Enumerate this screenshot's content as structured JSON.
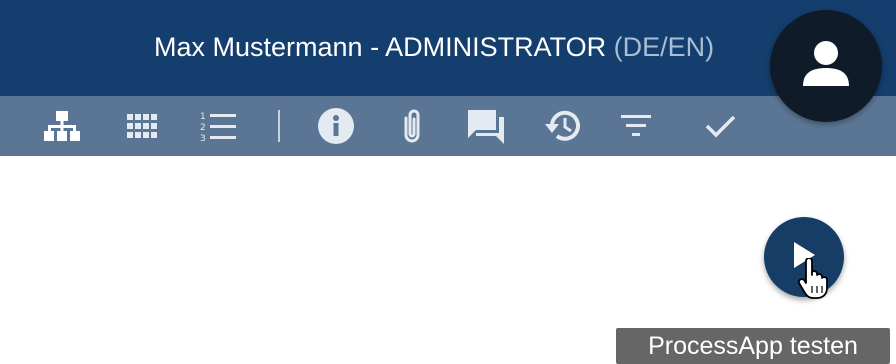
{
  "header": {
    "user_text": "Max Mustermann - ADMINISTRATOR",
    "language": "(DE/EN)"
  },
  "toolbar": {
    "icons": [
      {
        "name": "hierarchy-icon",
        "color": "#ffffff"
      },
      {
        "name": "grid-icon",
        "color": "#e4eaf1"
      },
      {
        "name": "numbered-list-icon",
        "color": "#e4eaf1"
      },
      {
        "name": "info-icon",
        "color": "#e4eaf1"
      },
      {
        "name": "attachment-icon",
        "color": "#e4eaf1"
      },
      {
        "name": "comments-icon",
        "color": "#e4eaf1"
      },
      {
        "name": "history-icon",
        "color": "#e4eaf1"
      },
      {
        "name": "filter-icon",
        "color": "#e4eaf1"
      },
      {
        "name": "check-icon",
        "color": "#e4eaf1"
      }
    ]
  },
  "avatar": {
    "icon": "user-icon"
  },
  "action": {
    "icon": "play-icon",
    "tooltip": "ProcessApp testen"
  },
  "colors": {
    "header_bg": "#143e6d",
    "toolbar_bg": "#5b7694",
    "play_button": "#153d66",
    "tooltip_bg": "#666666"
  }
}
